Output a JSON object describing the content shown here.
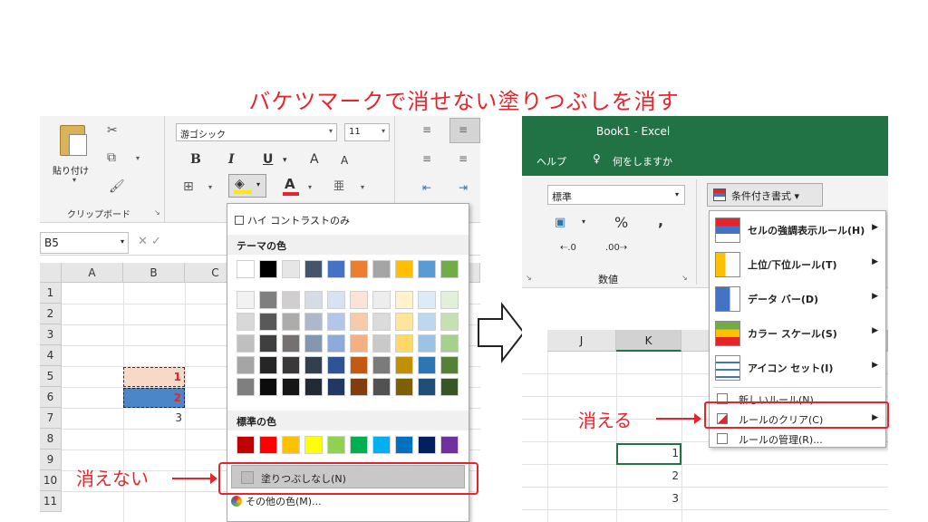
{
  "title": "バケツマークで消せない塗りつぶしを消す",
  "left": {
    "clipboard": {
      "paste_label": "貼り付け",
      "group_label": "クリップボード"
    },
    "font": {
      "font_name": "游ゴシック",
      "font_size": "11",
      "bold": "B",
      "italic": "I",
      "underline": "U",
      "grow": "A",
      "shrink": "A",
      "font_color_glyph": "A",
      "phonetic": "亜"
    },
    "name_box": "B5",
    "formula_icons": "✕ ✓",
    "columns": [
      "A",
      "B",
      "C"
    ],
    "rows": [
      "1",
      "2",
      "3",
      "4",
      "5",
      "6",
      "7",
      "8",
      "9",
      "10",
      "11"
    ],
    "cells": {
      "b5": "1",
      "b6": "2",
      "b7": "3"
    },
    "dropdown": {
      "high_contrast": "ハイ コントラストのみ",
      "theme_heading": "テーマの色",
      "standard_heading": "標準の色",
      "no_fill": "塗りつぶしなし(N)",
      "more_colors": "その他の色(M)...",
      "theme_colors": [
        [
          "#ffffff",
          "#000000",
          "#e7e6e6",
          "#44546a",
          "#4472c4",
          "#ed7d31",
          "#a5a5a5",
          "#ffc000",
          "#5b9bd5",
          "#70ad47"
        ],
        [
          "#f2f2f2",
          "#7f7f7f",
          "#d0cece",
          "#d6dce4",
          "#d9e2f3",
          "#fbe4d5",
          "#ededed",
          "#fff2cc",
          "#deebf6",
          "#e2efd9"
        ],
        [
          "#d8d8d8",
          "#595959",
          "#aeabab",
          "#adb9ca",
          "#b4c6e7",
          "#f7caac",
          "#dbdbdb",
          "#fee599",
          "#bdd7ee",
          "#c5e0b3"
        ],
        [
          "#bfbfbf",
          "#3f3f3f",
          "#757171",
          "#8496b0",
          "#8eaadb",
          "#f4b083",
          "#c9c9c9",
          "#ffd965",
          "#9cc3e5",
          "#a8d08d"
        ],
        [
          "#a5a5a5",
          "#262626",
          "#3a3838",
          "#323f4f",
          "#2f5496",
          "#c45911",
          "#7b7b7b",
          "#bf9000",
          "#2e75b5",
          "#538135"
        ],
        [
          "#7f7f7f",
          "#0c0c0c",
          "#171616",
          "#222a35",
          "#1f3864",
          "#833c0b",
          "#525252",
          "#7f6000",
          "#1f4e79",
          "#375623"
        ]
      ],
      "standard_colors": [
        "#c00000",
        "#ff0000",
        "#ffc000",
        "#ffff00",
        "#92d050",
        "#00b050",
        "#00b0f0",
        "#0070c0",
        "#002060",
        "#7030a0"
      ]
    },
    "caption": "消えない"
  },
  "right": {
    "window_title": "Book1  -  Excel",
    "tab_help": "ヘルプ",
    "tell_me": "何をしますか",
    "number_format": "標準",
    "number_group_label": "数値",
    "percent": "%",
    "comma": ",",
    "cond_format_button": "条件付き書式 ▾",
    "columns": [
      "J",
      "K"
    ],
    "cells": [
      "1",
      "2",
      "3"
    ],
    "menu": [
      {
        "label": "セルの強調表示ルール(H)"
      },
      {
        "label": "上位/下位ルール(T)"
      },
      {
        "label": "データ バー(D)"
      },
      {
        "label": "カラー スケール(S)"
      },
      {
        "label": "アイコン セット(I)"
      }
    ],
    "menu_small": {
      "new_rule": "新しいルール(N)...",
      "clear_rules": "ルールのクリア(C)",
      "manage_rules": "ルールの管理(R)..."
    },
    "caption": "消える"
  },
  "colors": {
    "accent_red": "#e8242b",
    "excel_green": "#217346"
  }
}
